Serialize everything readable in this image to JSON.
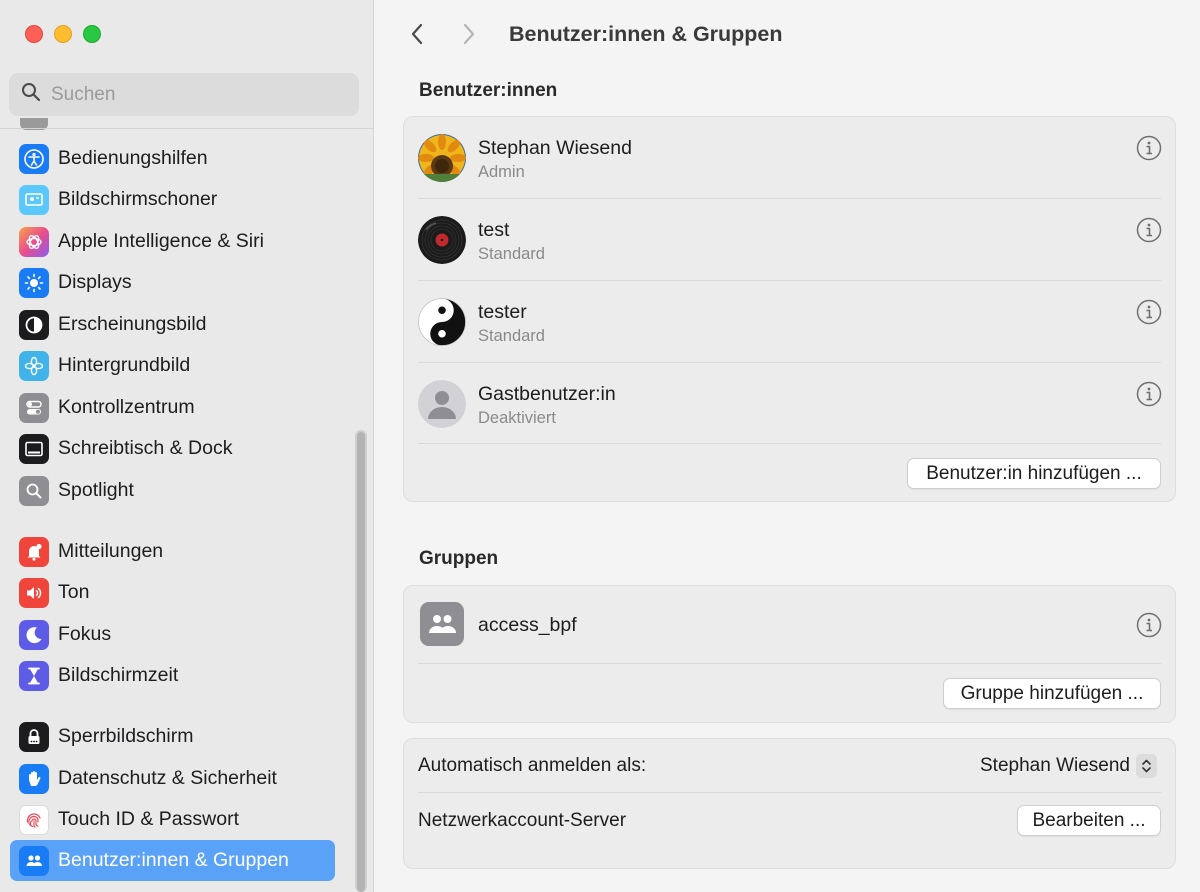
{
  "window": {
    "title": "Benutzer:innen & Gruppen"
  },
  "search": {
    "placeholder": "Suchen",
    "icon": "magnifier-icon"
  },
  "sidebar": {
    "items": [
      {
        "label": "Bedienungshilfen",
        "icon": "accessibility-icon",
        "color": "#1a7cf5"
      },
      {
        "label": "Bildschirmschoner",
        "icon": "screensaver-icon",
        "color": "#5ac8fa"
      },
      {
        "label": "Apple Intelligence & Siri",
        "icon": "siri-icon",
        "color": "#f06292"
      },
      {
        "label": "Displays",
        "icon": "sun-icon",
        "color": "#1a7cf5"
      },
      {
        "label": "Erscheinungsbild",
        "icon": "appearance-icon",
        "color": "#1c1c1e"
      },
      {
        "label": "Hintergrundbild",
        "icon": "flower-icon",
        "color": "#40b4e8"
      },
      {
        "label": "Kontrollzentrum",
        "icon": "toggles-icon",
        "color": "#8e8e93"
      },
      {
        "label": "Schreibtisch & Dock",
        "icon": "dock-icon",
        "color": "#1c1c1e"
      },
      {
        "label": "Spotlight",
        "icon": "spotlight-icon",
        "color": "#8e8e93"
      },
      {
        "label": "Mitteilungen",
        "icon": "bell-icon",
        "color": "#f0453a"
      },
      {
        "label": "Ton",
        "icon": "speaker-icon",
        "color": "#f0453a"
      },
      {
        "label": "Fokus",
        "icon": "moon-icon",
        "color": "#5e5ce6"
      },
      {
        "label": "Bildschirmzeit",
        "icon": "hourglass-icon",
        "color": "#5e5ce6"
      },
      {
        "label": "Sperrbildschirm",
        "icon": "lock-icon",
        "color": "#1c1c1e"
      },
      {
        "label": "Datenschutz & Sicherheit",
        "icon": "hand-icon",
        "color": "#1a7cf5"
      },
      {
        "label": "Touch ID & Passwort",
        "icon": "fingerprint-icon",
        "color": "#ffffff"
      },
      {
        "label": "Benutzer:innen & Gruppen",
        "icon": "users-icon",
        "color": "#1a7cf5"
      }
    ],
    "active_index": 16
  },
  "main": {
    "users_section_title": "Benutzer:innen",
    "users": [
      {
        "name": "Stephan Wiesend",
        "role": "Admin",
        "avatar": "sunflower-avatar"
      },
      {
        "name": "test",
        "role": "Standard",
        "avatar": "record-avatar"
      },
      {
        "name": "tester",
        "role": "Standard",
        "avatar": "yinyang-avatar"
      },
      {
        "name": "Gastbenutzer:in",
        "role": "Deaktiviert",
        "avatar": "guest-avatar"
      }
    ],
    "add_user_label": "Benutzer:in hinzufügen ...",
    "groups_section_title": "Gruppen",
    "groups": [
      {
        "name": "access_bpf",
        "icon": "group-icon"
      }
    ],
    "add_group_label": "Gruppe hinzufügen ...",
    "auto_login_label": "Automatisch anmelden als:",
    "auto_login_value": "Stephan Wiesend",
    "network_server_label": "Netzwerkaccount-Server",
    "edit_label": "Bearbeiten ..."
  }
}
